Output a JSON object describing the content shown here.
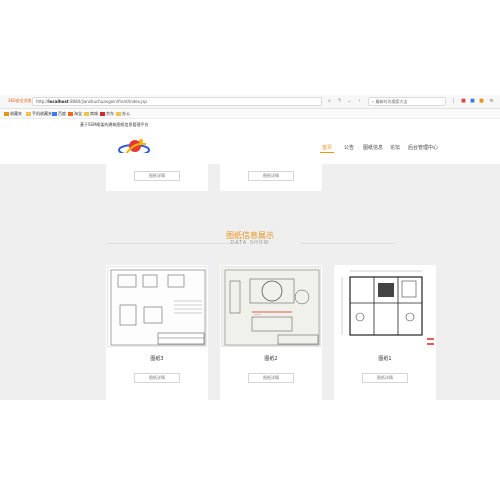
{
  "browser": {
    "brand": "360安全浏览器",
    "url_prefix": "http://",
    "url_host": "localhost",
    "url_path": ":8080/jianzhuchuangxin/front/index.jsp",
    "search_placeholder": "最新时讯搜索大全"
  },
  "bookmarks": [
    {
      "label": "收藏夹"
    },
    {
      "label": "手机收藏夹"
    },
    {
      "label": "百度"
    },
    {
      "label": "淘宝"
    },
    {
      "label": "商城"
    },
    {
      "label": "京东"
    },
    {
      "label": "办公"
    }
  ],
  "page_title": "基于SSM框架的建筑图纸信息管理平台",
  "nav": {
    "items": [
      {
        "label": "首页"
      },
      {
        "label": "公告"
      },
      {
        "label": "图纸信息"
      },
      {
        "label": "论坛"
      },
      {
        "label": "后台管理中心"
      }
    ]
  },
  "top_cards": [
    {
      "button": "图纸详情"
    },
    {
      "button": "图纸详情"
    }
  ],
  "section": {
    "title": "图纸信息展示",
    "subtitle": "DATA SHOW"
  },
  "cards": [
    {
      "title": "图纸3",
      "button": "图纸详情"
    },
    {
      "title": "图纸2",
      "button": "图纸详情"
    },
    {
      "title": "图纸1",
      "button": "图纸详情"
    }
  ],
  "colors": {
    "accent": "#e8931a",
    "background": "#efefef"
  }
}
